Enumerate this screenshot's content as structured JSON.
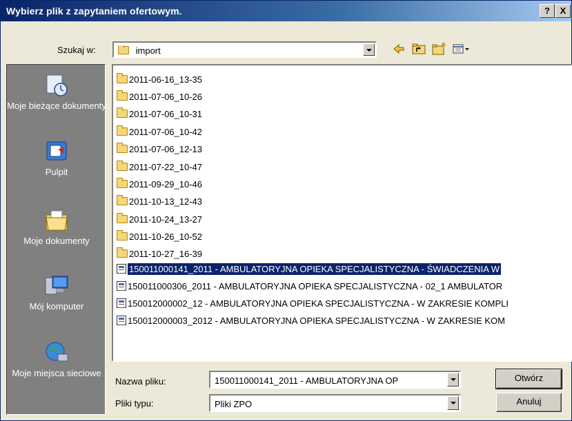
{
  "window": {
    "title": "Wybierz plik z zapytaniem ofertowym.",
    "help_label": "?",
    "close_label": "X"
  },
  "lookin": {
    "label": "Szukaj w:",
    "value": "import"
  },
  "toolbar": {
    "back_icon": "back-arrow-icon",
    "up_icon": "up-folder-icon",
    "new_folder_icon": "new-folder-icon",
    "view_icon": "view-menu-icon"
  },
  "places": [
    {
      "label": "Moje bieżące dokumenty",
      "icon": "recent-documents-icon"
    },
    {
      "label": "Pulpit",
      "icon": "desktop-icon"
    },
    {
      "label": "Moje dokumenty",
      "icon": "my-documents-icon"
    },
    {
      "label": "Mój komputer",
      "icon": "my-computer-icon"
    },
    {
      "label": "Moje miejsca sieciowe",
      "icon": "network-places-icon"
    }
  ],
  "files": [
    {
      "name": "2011-06-16_13-35",
      "type": "folder"
    },
    {
      "name": "2011-07-06_10-26",
      "type": "folder"
    },
    {
      "name": "2011-07-06_10-31",
      "type": "folder"
    },
    {
      "name": "2011-07-06_10-42",
      "type": "folder"
    },
    {
      "name": "2011-07-06_12-13",
      "type": "folder"
    },
    {
      "name": "2011-07-22_10-47",
      "type": "folder"
    },
    {
      "name": "2011-09-29_10-46",
      "type": "folder"
    },
    {
      "name": "2011-10-13_12-43",
      "type": "folder"
    },
    {
      "name": "2011-10-24_13-27",
      "type": "folder"
    },
    {
      "name": "2011-10-26_10-52",
      "type": "folder"
    },
    {
      "name": "2011-10-27_16-39",
      "type": "folder"
    },
    {
      "name": "150011000141_2011 - AMBULATORYJNA OPIEKA SPECJALISTYCZNA - ŚWIADCZENIA W",
      "type": "file",
      "selected": true
    },
    {
      "name": "150011000306_2011 - AMBULATORYJNA OPIEKA SPECJALISTYCZNA  - 02_1 AMBULATOR",
      "type": "file"
    },
    {
      "name": "150012000002_12 - AMBULATORYJNA OPIEKA SPECJALISTYCZNA - W ZAKRESIE KOMPLI",
      "type": "file"
    },
    {
      "name": "150012000003_2012 - AMBULATORYJNA OPIEKA SPECJALISTYCZNA - W ZAKRESIE KOM",
      "type": "file"
    }
  ],
  "filename": {
    "label": "Nazwa pliku:",
    "value": "150011000141_2011 - AMBULATORYJNA OP"
  },
  "filetype": {
    "label": "Pliki typu:",
    "value": "Pliki ZPO"
  },
  "buttons": {
    "open": "Otwórz",
    "cancel": "Anuluj"
  },
  "colors": {
    "selection": "#0a246a",
    "title_gradient_start": "#0a246a",
    "places_bg": "#808080"
  }
}
